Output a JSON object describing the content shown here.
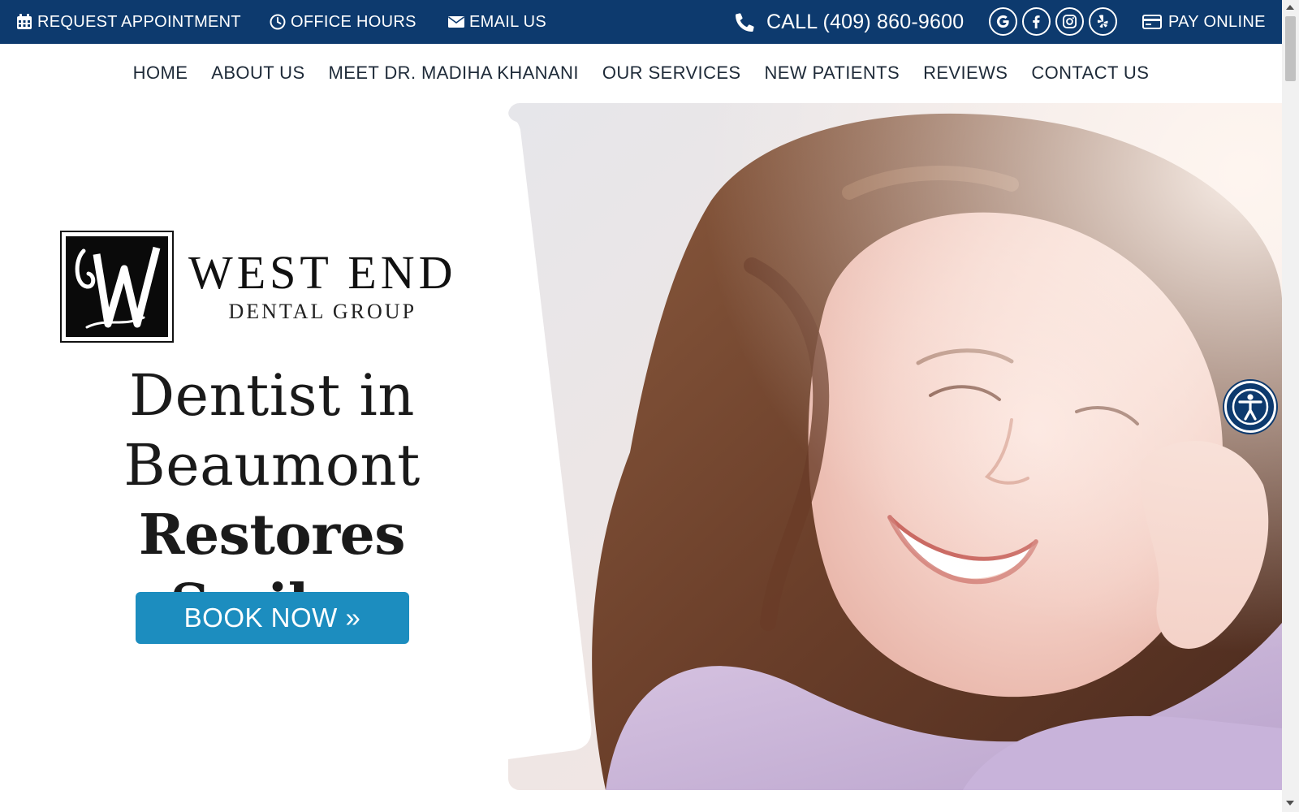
{
  "topbar": {
    "request_appointment": "REQUEST APPOINTMENT",
    "office_hours": "OFFICE HOURS",
    "email_us": "EMAIL US",
    "call": "CALL (409) 860-9600",
    "pay_online": "PAY ONLINE",
    "socials": [
      "google-icon",
      "facebook-icon",
      "instagram-icon",
      "yelp-icon"
    ]
  },
  "nav": {
    "items": [
      "HOME",
      "ABOUT US",
      "MEET DR. MADIHA KHANANI",
      "OUR SERVICES",
      "NEW PATIENTS",
      "REVIEWS",
      "CONTACT US"
    ]
  },
  "hero": {
    "logo_line1": "WEST END",
    "logo_line2": "DENTAL GROUP",
    "headline_line1": "Dentist in",
    "headline_line2": "Beaumont",
    "headline_line3": "Restores Smiles",
    "cta": "BOOK NOW »"
  },
  "colors": {
    "topbar_bg": "#0d3a6e",
    "cta_bg": "#1c8dbf",
    "nav_text": "#1e2a38"
  }
}
